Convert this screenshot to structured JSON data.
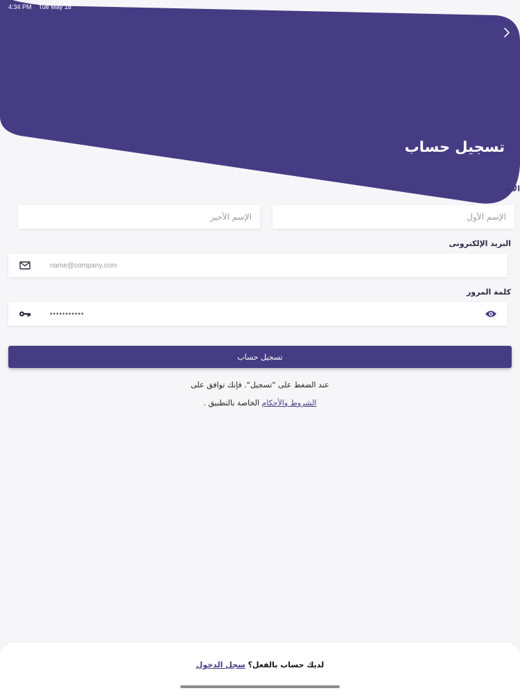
{
  "status_bar": {
    "time": "4:34 PM",
    "date": "Tue May 18"
  },
  "header": {
    "title": "تسجيل حساب",
    "back_icon": "chevron-right-icon",
    "peek_label": "الاسم"
  },
  "form": {
    "first_name": {
      "placeholder": "الإسم الأول",
      "value": ""
    },
    "last_name": {
      "placeholder": "الإسم الأخير",
      "value": ""
    },
    "email": {
      "label": "البريد الإلكترونى",
      "placeholder": "name@company.com",
      "icon": "mail-icon"
    },
    "password": {
      "label": "كلمة المرور",
      "value": "•••••••••••",
      "icon": "key-icon",
      "toggle_icon": "eye-icon"
    },
    "submit_label": "تسجيل حساب"
  },
  "terms": {
    "line1": "عند الضغط على \"تسجيل\". فإنك توافق على",
    "link": "الشروط والأحكام",
    "line2_suffix": " الخاصة بالتطبيق ."
  },
  "footer": {
    "prompt": "لديك حساب بالفعل؟ ",
    "login_link": "سجل الدخول"
  },
  "colors": {
    "primary": "#463c84",
    "background": "#f6f5f8",
    "field_bg": "#ffffff"
  }
}
